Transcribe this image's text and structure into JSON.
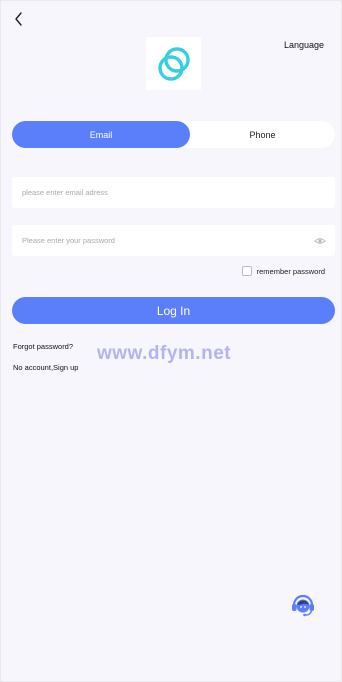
{
  "header": {
    "language_label": "Language"
  },
  "tabs": [
    {
      "label": "Email",
      "active": true
    },
    {
      "label": "Phone",
      "active": false
    }
  ],
  "form": {
    "email_placeholder": "please enter email adress",
    "password_placeholder": "Please enter your password",
    "remember_label": "remember password",
    "remember_checked": false,
    "login_label": "Log In"
  },
  "links": {
    "forgot_password": "Forgot password?",
    "no_account": "No account,",
    "sign_up": "Sign up"
  },
  "watermark": "www.dfym.net",
  "icons": {
    "back": "chevron-left-icon",
    "logo": "brand-logo-icon",
    "eye": "eye-icon",
    "support": "customer-support-icon"
  },
  "colors": {
    "accent": "#5b7ffb",
    "background": "#f6f6fc",
    "logo": "#35d0e0"
  }
}
